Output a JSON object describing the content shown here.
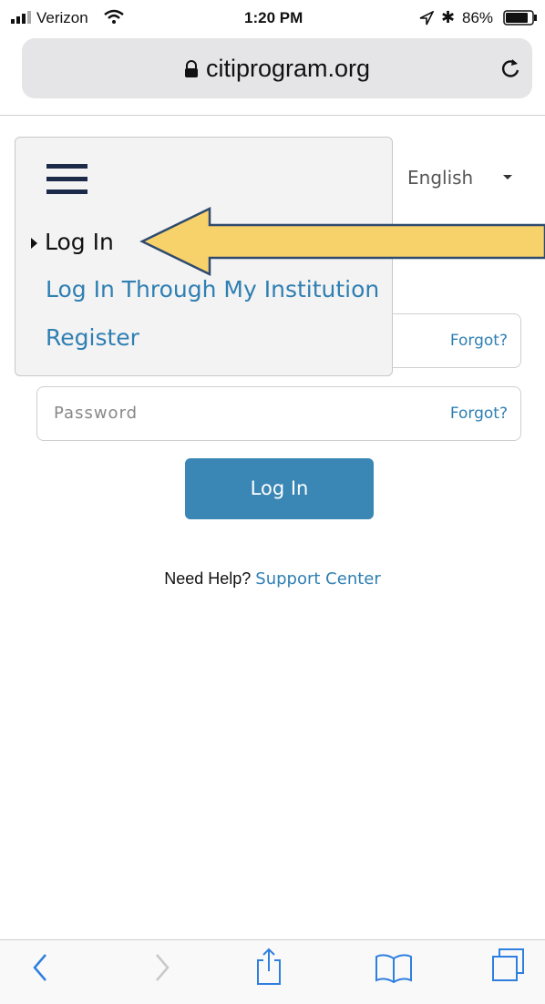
{
  "status_bar": {
    "carrier": "Verizon",
    "time": "1:20 PM",
    "battery": "86%"
  },
  "address_bar": {
    "domain": "citiprogram.org"
  },
  "language": {
    "selected": "English"
  },
  "menu": {
    "items": [
      {
        "label": "Log In"
      },
      {
        "label": "Log In Through My Institution"
      },
      {
        "label": "Register"
      }
    ]
  },
  "form": {
    "username_forgot": "Forgot?",
    "password_placeholder": "Password",
    "password_forgot": "Forgot?",
    "submit_label": "Log In"
  },
  "help": {
    "prefix": "Need Help?",
    "link": "Support Center"
  },
  "icons": {
    "lock": "lock-icon",
    "reload": "reload-icon",
    "back": "back-icon",
    "forward": "forward-icon",
    "share": "share-icon",
    "bookmarks": "bookmarks-icon",
    "tabs": "tabs-icon"
  },
  "colors": {
    "accent": "#3a86b5",
    "link": "#2f7fb3",
    "arrow_fill": "#f7d26b",
    "arrow_stroke": "#2f4a6e"
  }
}
